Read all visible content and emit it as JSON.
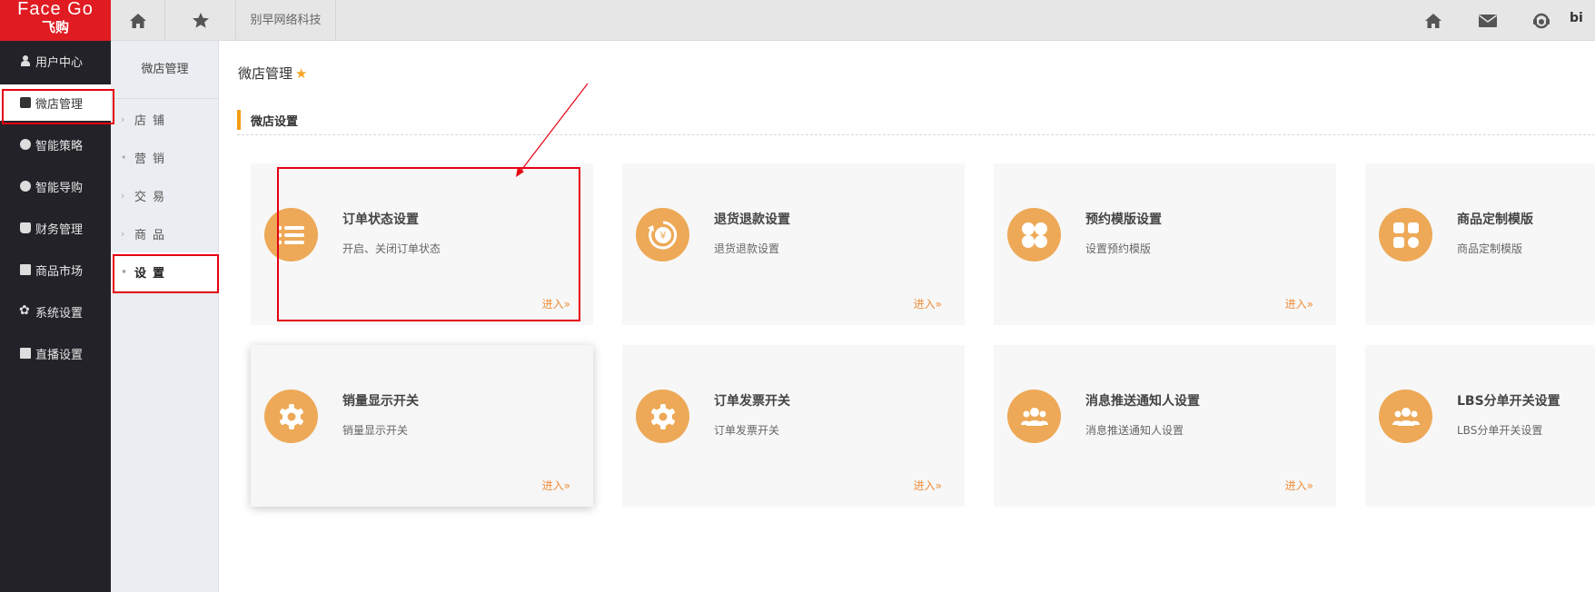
{
  "logo": {
    "line1": "Face Go",
    "line2": "飞购"
  },
  "sidebar": {
    "items": [
      {
        "label": "用户中心",
        "icon": "user-icon"
      },
      {
        "label": "微店管理",
        "icon": "shop-icon"
      },
      {
        "label": "智能策略",
        "icon": "strategy-icon"
      },
      {
        "label": "智能导购",
        "icon": "guide-icon"
      },
      {
        "label": "财务管理",
        "icon": "money-bag-icon"
      },
      {
        "label": "商品市场",
        "icon": "market-icon"
      },
      {
        "label": "系统设置",
        "icon": "gear-icon"
      },
      {
        "label": "直播设置",
        "icon": "live-folder-icon"
      }
    ]
  },
  "topbar": {
    "company": "别早网络科技",
    "user": "bi"
  },
  "subnav": {
    "title": "微店管理",
    "items": [
      {
        "label": "店铺",
        "bullet": "›"
      },
      {
        "label": "营销",
        "bullet": "•"
      },
      {
        "label": "交易",
        "bullet": "›"
      },
      {
        "label": "商品",
        "bullet": "›"
      },
      {
        "label": "设置",
        "bullet": "•"
      }
    ]
  },
  "main": {
    "page_title": "微店管理",
    "section_title": "微店设置",
    "enter_label": "进入»",
    "cards": [
      {
        "title": "订单状态设置",
        "desc": "开启、关闭订单状态",
        "icon": "list-icon"
      },
      {
        "title": "退货退款设置",
        "desc": "退货退款设置",
        "icon": "refund-icon"
      },
      {
        "title": "预约模版设置",
        "desc": "设置预约模版",
        "icon": "clover-icon"
      },
      {
        "title": "商品定制模版",
        "desc": "商品定制模版",
        "icon": "grid-icon"
      },
      {
        "title": "销量显示开关",
        "desc": "销量显示开关",
        "icon": "gear-icon"
      },
      {
        "title": "订单发票开关",
        "desc": "订单发票开关",
        "icon": "gear-icon"
      },
      {
        "title": "消息推送通知人设置",
        "desc": "消息推送通知人设置",
        "icon": "users-icon"
      },
      {
        "title": "LBS分单开关设置",
        "desc": "LBS分单开关设置",
        "icon": "users-icon"
      }
    ]
  },
  "colors": {
    "sidebar_bg": "#242229",
    "logo_bg": "#e01b22",
    "accent_orange": "#eda957",
    "highlight_red": "#e60012"
  }
}
